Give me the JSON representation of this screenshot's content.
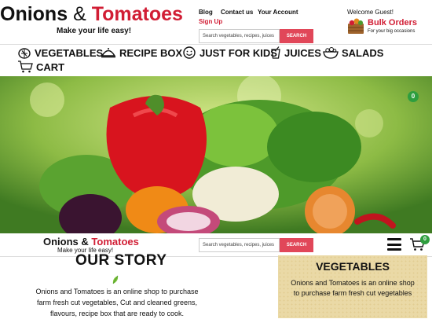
{
  "header": {
    "brand_left": "Onions",
    "brand_amp": "&",
    "brand_right": "Tomatoes",
    "tagline": "Make your life easy!",
    "links": [
      "Blog",
      "Contact us",
      "Your Account"
    ],
    "signup": "Sign Up",
    "search_placeholder": "Search vegetables, recipes, juices",
    "search_button": "SEARCH",
    "welcome": "Welcome Guest!",
    "bulk_title": "Bulk Orders",
    "bulk_sub": "For your big occasions"
  },
  "nav": [
    {
      "label": "VEGETABLES",
      "icon": "vegetable-icon"
    },
    {
      "label": "RECIPE BOX",
      "icon": "cloche-icon"
    },
    {
      "label": "JUST FOR KIDS",
      "icon": "smiley-icon"
    },
    {
      "label": "JUICES",
      "icon": "juice-cup-icon"
    },
    {
      "label": "SALADS",
      "icon": "salad-bowl-icon"
    },
    {
      "label": "CART",
      "icon": "cart-icon"
    }
  ],
  "banner": {
    "cart_count": "0"
  },
  "sticky": {
    "brand_left": "Onions",
    "brand_amp": "&",
    "brand_right": "Tomatoes",
    "tagline": "Make your life easy!",
    "search_placeholder": "Search vegetables, recipes, juices",
    "search_button": "SEARCH",
    "cart_count": "0"
  },
  "story": {
    "title": "OUR STORY",
    "text": "Onions and Tomatoes is an online shop to purchase farm fresh cut vegetables, Cut and cleaned greens, flavours, recipe box that are ready to cook."
  },
  "vegetables_card": {
    "title": "VEGETABLES",
    "text": "Onions and Tomatoes is an online shop to purchase farm fresh cut vegetables"
  },
  "colors": {
    "brand_red": "#d11d34",
    "search_button": "#e14759",
    "badge_green": "#2e9e3e",
    "card_bg": "#ead9a6"
  }
}
